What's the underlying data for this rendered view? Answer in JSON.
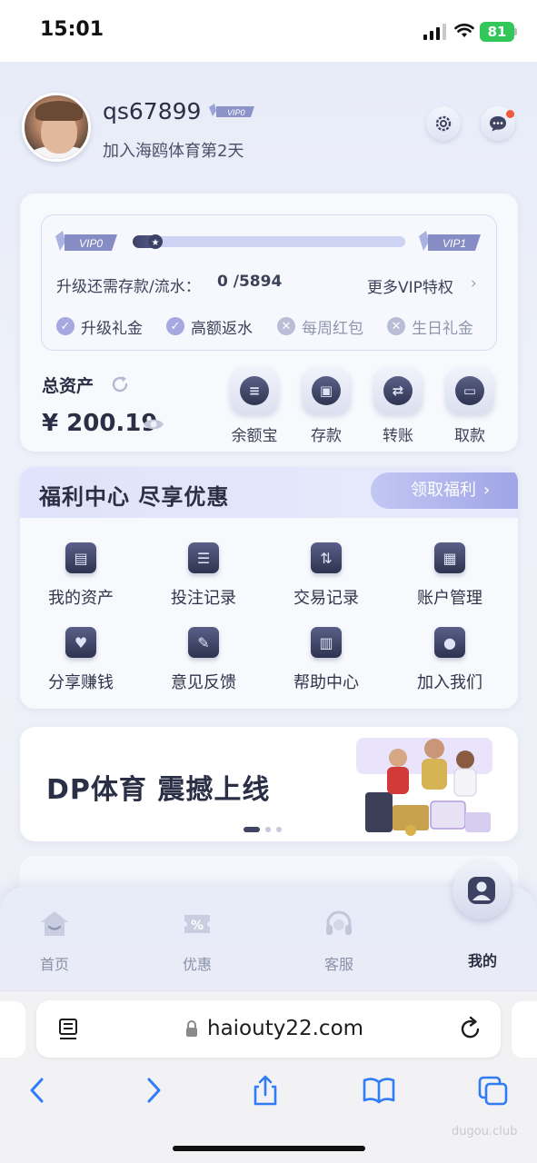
{
  "status_bar": {
    "time": "15:01",
    "battery": "81"
  },
  "profile": {
    "username": "qs67899",
    "vip_badge": "VIP0",
    "join_text": "加入海鸥体育第2天"
  },
  "vip": {
    "current_level": "VIP0",
    "next_level": "VIP1",
    "progress_marker": "★",
    "progress_fraction": 0.1,
    "upgrade_label": "升级还需存款/流水：",
    "upgrade_value": "0 /5894",
    "more_vip": "更多VIP特权",
    "perks": [
      {
        "label": "升级礼金",
        "unlocked": true
      },
      {
        "label": "高额返水",
        "unlocked": true
      },
      {
        "label": "每周红包",
        "unlocked": false
      },
      {
        "label": "生日礼金",
        "unlocked": false
      }
    ]
  },
  "assets": {
    "label": "总资产",
    "balance": "¥ 200.19",
    "actions": [
      {
        "label": "余额宝",
        "icon": "coin-stack-icon"
      },
      {
        "label": "存款",
        "icon": "wallet-lock-icon"
      },
      {
        "label": "转账",
        "icon": "transfer-icon"
      },
      {
        "label": "取款",
        "icon": "card-icon"
      }
    ]
  },
  "welfare": {
    "title": "福利中心  尽享优惠",
    "claim_label": "领取福利",
    "items": [
      {
        "label": "我的资产",
        "icon": "wallet-icon"
      },
      {
        "label": "投注记录",
        "icon": "list-icon"
      },
      {
        "label": "交易记录",
        "icon": "exchange-icon"
      },
      {
        "label": "账户管理",
        "icon": "folder-icon"
      },
      {
        "label": "分享赚钱",
        "icon": "handshake-icon"
      },
      {
        "label": "意见反馈",
        "icon": "edit-icon"
      },
      {
        "label": "帮助中心",
        "icon": "book-icon"
      },
      {
        "label": "加入我们",
        "icon": "users-icon"
      }
    ]
  },
  "banner": {
    "title": "DP体育 震撼上线",
    "slide_count": 3,
    "active_slide": 1
  },
  "tabbar": [
    {
      "label": "首页",
      "icon": "home-icon",
      "active": false
    },
    {
      "label": "优惠",
      "icon": "coupon-icon",
      "active": false
    },
    {
      "label": "客服",
      "icon": "headset-icon",
      "active": false
    },
    {
      "label": "我的",
      "icon": "profile-icon",
      "active": true
    }
  ],
  "browser": {
    "url": "haiouty22.com"
  },
  "watermark": "dugou.club",
  "colors": {
    "accent": "#a6a8e0",
    "dark": "#2a2f45",
    "battery": "#33c759",
    "notify": "#f25a3c"
  }
}
